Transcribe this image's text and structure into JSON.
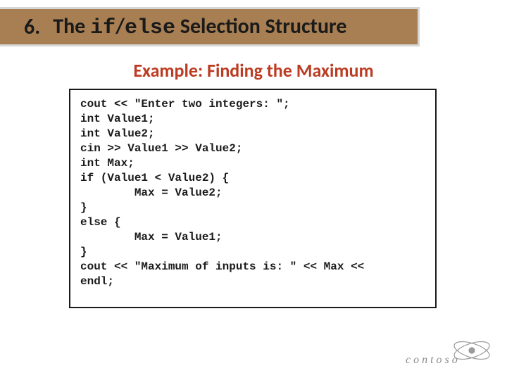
{
  "title": {
    "number": "6.",
    "pre": "The ",
    "mono1": "if",
    "slash": "/",
    "mono2": "else",
    "post": " Selection Structure"
  },
  "subhead": "Example: Finding the Maximum",
  "code": "cout << \"Enter two integers: \";\nint Value1;\nint Value2;\ncin >> Value1 >> Value2;\nint Max;\nif (Value1 < Value2) {\n        Max = Value2;\n}\nelse {\n        Max = Value1;\n}\ncout << \"Maximum of inputs is: \" << Max <<\nendl;",
  "logo_text": "contoso"
}
